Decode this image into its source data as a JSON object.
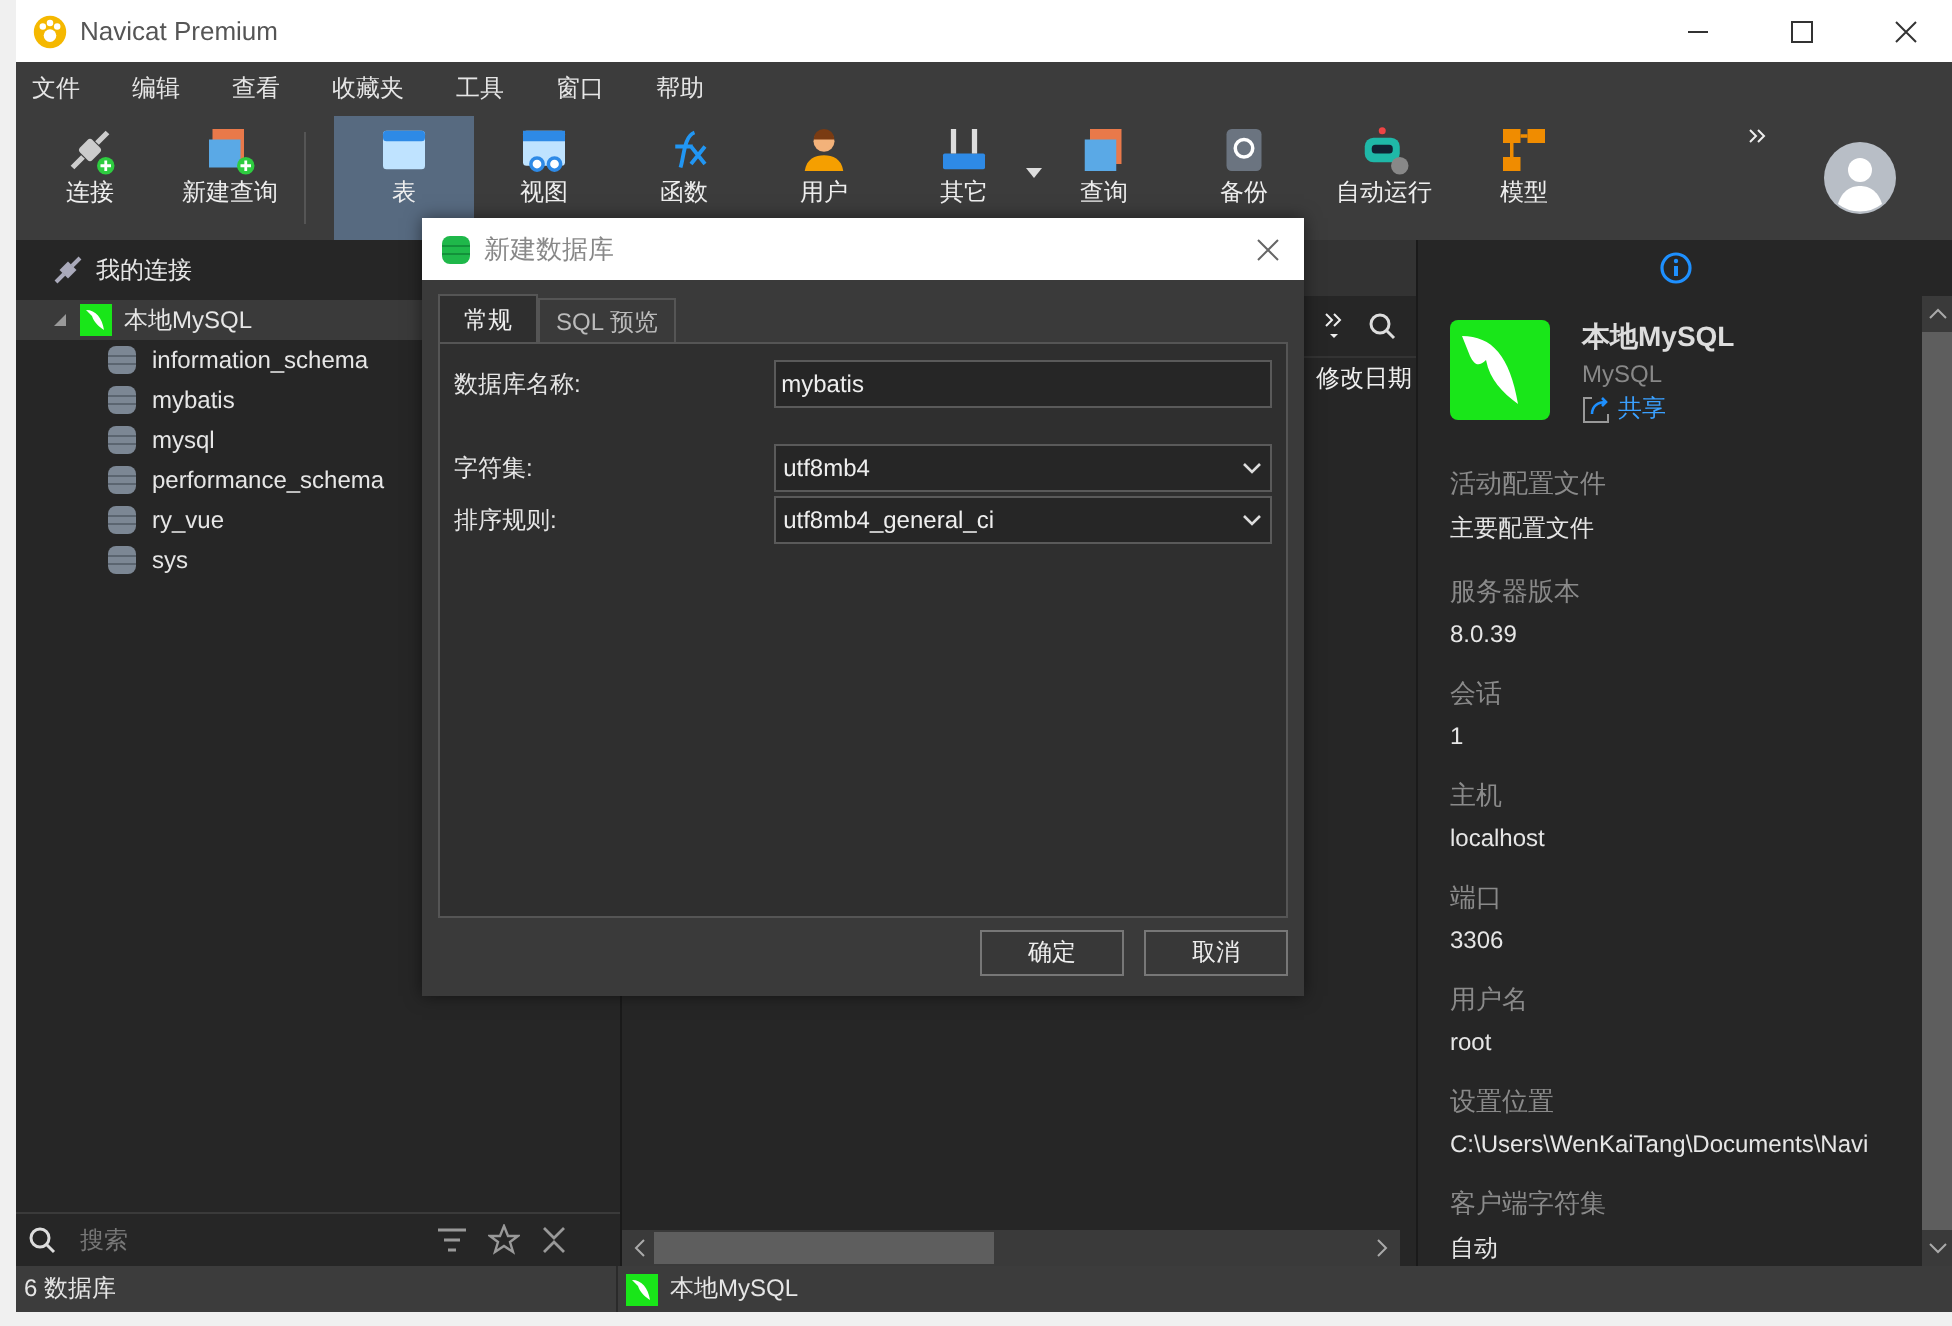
{
  "window": {
    "title": "Navicat Premium"
  },
  "menu": [
    "文件",
    "编辑",
    "查看",
    "收藏夹",
    "工具",
    "窗口",
    "帮助"
  ],
  "toolbar_left": [
    {
      "label": "连接",
      "selected": false,
      "dropdown": false
    },
    {
      "label": "新建查询",
      "selected": false,
      "dropdown": false
    }
  ],
  "toolbar_main": [
    {
      "label": "表",
      "selected": true,
      "dropdown": false
    },
    {
      "label": "视图",
      "selected": false,
      "dropdown": false
    },
    {
      "label": "函数",
      "selected": false,
      "dropdown": false
    },
    {
      "label": "用户",
      "selected": false,
      "dropdown": false
    },
    {
      "label": "其它",
      "selected": false,
      "dropdown": true
    },
    {
      "label": "查询",
      "selected": false,
      "dropdown": false
    },
    {
      "label": "备份",
      "selected": false,
      "dropdown": false
    },
    {
      "label": "自动运行",
      "selected": false,
      "dropdown": false
    },
    {
      "label": "模型",
      "selected": false,
      "dropdown": false
    }
  ],
  "connection_panel": {
    "header": "我的连接",
    "connection": {
      "name": "本地MySQL",
      "expanded": true,
      "selected": true,
      "children": [
        {
          "name": "information_schema"
        },
        {
          "name": "mybatis"
        },
        {
          "name": "mysql"
        },
        {
          "name": "performance_schema"
        },
        {
          "name": "ry_vue"
        },
        {
          "name": "sys"
        }
      ]
    },
    "search_placeholder": "搜索"
  },
  "object_panel": {
    "column_header": "修改日期"
  },
  "info_panel": {
    "name": "本地MySQL",
    "type": "MySQL",
    "share": "共享",
    "fields": [
      {
        "label": "活动配置文件",
        "value": "主要配置文件"
      },
      {
        "label": "服务器版本",
        "value": "8.0.39"
      },
      {
        "label": "会话",
        "value": "1"
      },
      {
        "label": "主机",
        "value": "localhost"
      },
      {
        "label": "端口",
        "value": "3306"
      },
      {
        "label": "用户名",
        "value": "root"
      },
      {
        "label": "设置位置",
        "value": "C:\\Users\\WenKaiTang\\Documents\\Navi"
      },
      {
        "label": "客户端字符集",
        "value": "自动"
      }
    ]
  },
  "status_bar": {
    "count": "6 数据库",
    "connection": "本地MySQL"
  },
  "dialog": {
    "title": "新建数据库",
    "tabs": [
      {
        "label": "常规",
        "selected": true
      },
      {
        "label": "SQL 预览",
        "selected": false
      }
    ],
    "fields": [
      {
        "label": "数据库名称:",
        "value": "mybatis",
        "kind": "text"
      },
      {
        "label": "字符集:",
        "value": "utf8mb4",
        "kind": "select"
      },
      {
        "label": "排序规则:",
        "value": "utf8mb4_general_ci",
        "kind": "select"
      }
    ],
    "buttons": [
      "确定",
      "取消"
    ]
  }
}
